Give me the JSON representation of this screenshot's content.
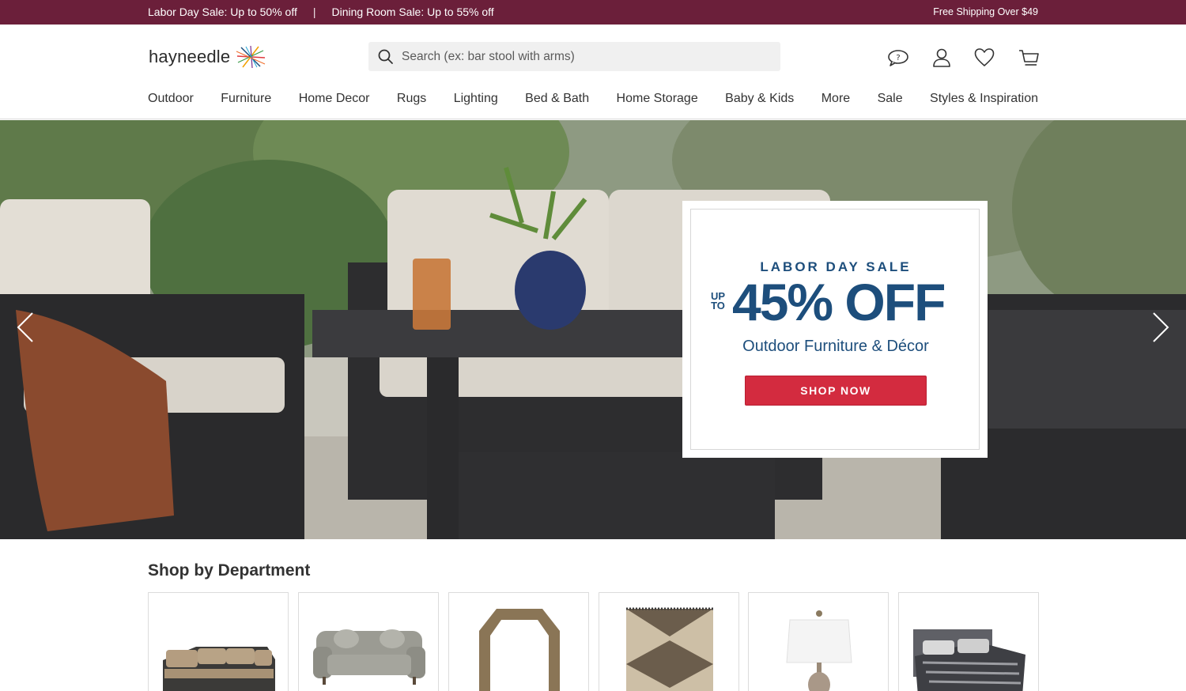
{
  "promo_bar": {
    "message_1": "Labor Day Sale: Up to 50% off",
    "separator": "|",
    "message_2": "Dining Room Sale: Up to 55% off",
    "shipping": "Free Shipping Over $49"
  },
  "header": {
    "logo_text": "hayneedle",
    "search": {
      "placeholder": "Search (ex: bar stool with arms)",
      "value": ""
    },
    "icons": [
      "help-chat-icon",
      "account-icon",
      "wishlist-heart-icon",
      "cart-icon"
    ]
  },
  "nav": {
    "items": [
      "Outdoor",
      "Furniture",
      "Home Decor",
      "Rugs",
      "Lighting",
      "Bed & Bath",
      "Home Storage",
      "Baby & Kids",
      "More",
      "Sale",
      "Styles & Inspiration"
    ]
  },
  "hero": {
    "eyebrow": "LABOR DAY SALE",
    "up_to": "UP TO",
    "up": "UP",
    "to": "TO",
    "discount": "45% OFF",
    "subtitle": "Outdoor Furniture & Décor",
    "cta": "SHOP NOW",
    "colors": {
      "brand_navy": "#1d4e7c",
      "cta_red": "#d32b3f",
      "promo_bar": "#6b1f3a"
    }
  },
  "department": {
    "title": "Shop by Department",
    "tiles": [
      "sectional-sofa-image",
      "loveseat-image",
      "mirror-image",
      "area-rug-image",
      "table-lamp-image",
      "bedding-image"
    ]
  }
}
